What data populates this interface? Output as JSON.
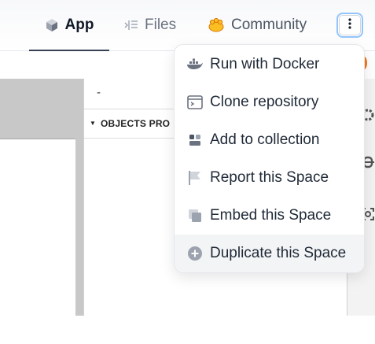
{
  "header": {
    "tabs": [
      {
        "label": "App",
        "icon": "cube-icon",
        "active": true
      },
      {
        "label": "Files",
        "icon": "files-icon"
      },
      {
        "label": "Community",
        "icon": "community-icon"
      }
    ],
    "more_button_icon": "vertical-dots-icon"
  },
  "app_panel": {
    "field_value": "-",
    "section_label": "OBJECTS PRO"
  },
  "menu": {
    "items": [
      {
        "label": "Run with Docker",
        "icon": "docker-icon"
      },
      {
        "label": "Clone repository",
        "icon": "terminal-icon"
      },
      {
        "label": "Add to collection",
        "icon": "collection-icon"
      },
      {
        "label": "Report this Space",
        "icon": "flag-icon"
      },
      {
        "label": "Embed this Space",
        "icon": "embed-icon"
      },
      {
        "label": "Duplicate this Space",
        "icon": "duplicate-icon",
        "highlighted": true
      }
    ]
  },
  "colors": {
    "accent_focus": "#93c5fd",
    "orange": "#f97316",
    "community_yellow": "#fbbf24"
  }
}
